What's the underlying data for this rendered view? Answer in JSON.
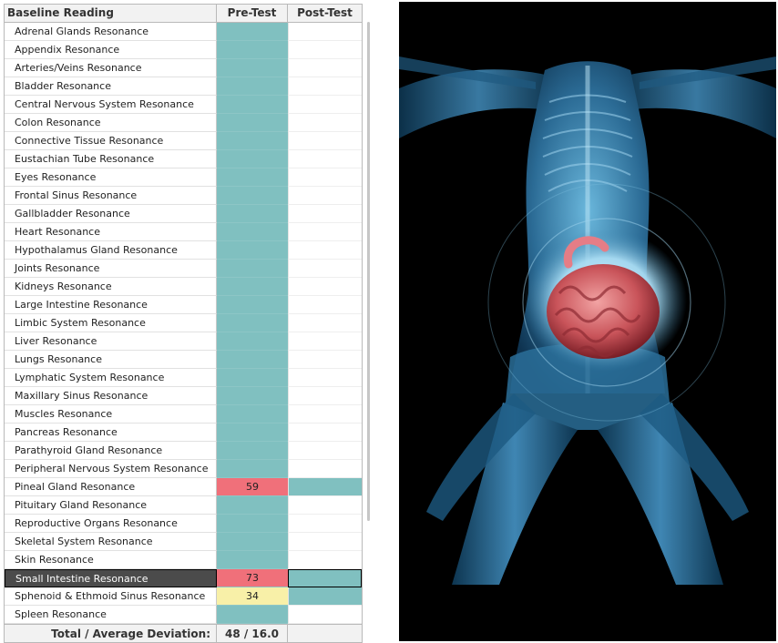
{
  "table": {
    "headers": {
      "name": "Baseline Reading",
      "pre": "Pre-Test",
      "post": "Post-Test"
    },
    "rows": [
      {
        "name": "Adrenal Glands Resonance",
        "pre": "",
        "post": "",
        "pre_color": "#80c0c0",
        "post_color": ""
      },
      {
        "name": "Appendix Resonance",
        "pre": "",
        "post": "",
        "pre_color": "#80c0c0",
        "post_color": ""
      },
      {
        "name": "Arteries/Veins Resonance",
        "pre": "",
        "post": "",
        "pre_color": "#80c0c0",
        "post_color": ""
      },
      {
        "name": "Bladder Resonance",
        "pre": "",
        "post": "",
        "pre_color": "#80c0c0",
        "post_color": ""
      },
      {
        "name": "Central Nervous System  Resonance",
        "pre": "",
        "post": "",
        "pre_color": "#80c0c0",
        "post_color": ""
      },
      {
        "name": "Colon Resonance",
        "pre": "",
        "post": "",
        "pre_color": "#80c0c0",
        "post_color": ""
      },
      {
        "name": "Connective Tissue Resonance",
        "pre": "",
        "post": "",
        "pre_color": "#80c0c0",
        "post_color": ""
      },
      {
        "name": "Eustachian Tube Resonance",
        "pre": "",
        "post": "",
        "pre_color": "#80c0c0",
        "post_color": ""
      },
      {
        "name": "Eyes Resonance",
        "pre": "",
        "post": "",
        "pre_color": "#80c0c0",
        "post_color": ""
      },
      {
        "name": "Frontal Sinus Resonance",
        "pre": "",
        "post": "",
        "pre_color": "#80c0c0",
        "post_color": ""
      },
      {
        "name": "Gallbladder Resonance",
        "pre": "",
        "post": "",
        "pre_color": "#80c0c0",
        "post_color": ""
      },
      {
        "name": "Heart Resonance",
        "pre": "",
        "post": "",
        "pre_color": "#80c0c0",
        "post_color": ""
      },
      {
        "name": "Hypothalamus Gland Resonance",
        "pre": "",
        "post": "",
        "pre_color": "#80c0c0",
        "post_color": ""
      },
      {
        "name": "Joints Resonance",
        "pre": "",
        "post": "",
        "pre_color": "#80c0c0",
        "post_color": ""
      },
      {
        "name": "Kidneys Resonance",
        "pre": "",
        "post": "",
        "pre_color": "#80c0c0",
        "post_color": ""
      },
      {
        "name": "Large Intestine Resonance",
        "pre": "",
        "post": "",
        "pre_color": "#80c0c0",
        "post_color": ""
      },
      {
        "name": "Limbic System Resonance",
        "pre": "",
        "post": "",
        "pre_color": "#80c0c0",
        "post_color": ""
      },
      {
        "name": "Liver Resonance",
        "pre": "",
        "post": "",
        "pre_color": "#80c0c0",
        "post_color": ""
      },
      {
        "name": "Lungs Resonance",
        "pre": "",
        "post": "",
        "pre_color": "#80c0c0",
        "post_color": ""
      },
      {
        "name": "Lymphatic System Resonance",
        "pre": "",
        "post": "",
        "pre_color": "#80c0c0",
        "post_color": ""
      },
      {
        "name": "Maxillary Sinus Resonance",
        "pre": "",
        "post": "",
        "pre_color": "#80c0c0",
        "post_color": ""
      },
      {
        "name": "Muscles Resonance",
        "pre": "",
        "post": "",
        "pre_color": "#80c0c0",
        "post_color": ""
      },
      {
        "name": "Pancreas Resonance",
        "pre": "",
        "post": "",
        "pre_color": "#80c0c0",
        "post_color": ""
      },
      {
        "name": "Parathyroid Gland Resonance",
        "pre": "",
        "post": "",
        "pre_color": "#80c0c0",
        "post_color": ""
      },
      {
        "name": "Peripheral Nervous System Resonance",
        "pre": "",
        "post": "",
        "pre_color": "#80c0c0",
        "post_color": ""
      },
      {
        "name": "Pineal Gland Resonance",
        "pre": "59",
        "post": "",
        "pre_color": "#f0707a",
        "post_color": "#80c0c0"
      },
      {
        "name": "Pituitary Gland Resonance",
        "pre": "",
        "post": "",
        "pre_color": "#80c0c0",
        "post_color": ""
      },
      {
        "name": "Reproductive Organs Resonance",
        "pre": "",
        "post": "",
        "pre_color": "#80c0c0",
        "post_color": ""
      },
      {
        "name": "Skeletal System Resonance",
        "pre": "",
        "post": "",
        "pre_color": "#80c0c0",
        "post_color": ""
      },
      {
        "name": "Skin Resonance",
        "pre": "",
        "post": "",
        "pre_color": "#80c0c0",
        "post_color": ""
      },
      {
        "name": "Small Intestine Resonance",
        "pre": "73",
        "post": "",
        "pre_color": "#f0707a",
        "post_color": "#80c0c0",
        "selected": true
      },
      {
        "name": "Sphenoid & Ethmoid Sinus Resonance",
        "pre": "34",
        "post": "",
        "pre_color": "#f8f0a8",
        "post_color": "#80c0c0"
      },
      {
        "name": "Spleen Resonance",
        "pre": "",
        "post": "",
        "pre_color": "#80c0c0",
        "post_color": ""
      }
    ],
    "footer": {
      "label": "Total / Average Deviation:",
      "value": "48 / 16.0"
    }
  },
  "figure": {
    "subject": "translucent-blue-human-body-small-intestine-highlighted"
  }
}
